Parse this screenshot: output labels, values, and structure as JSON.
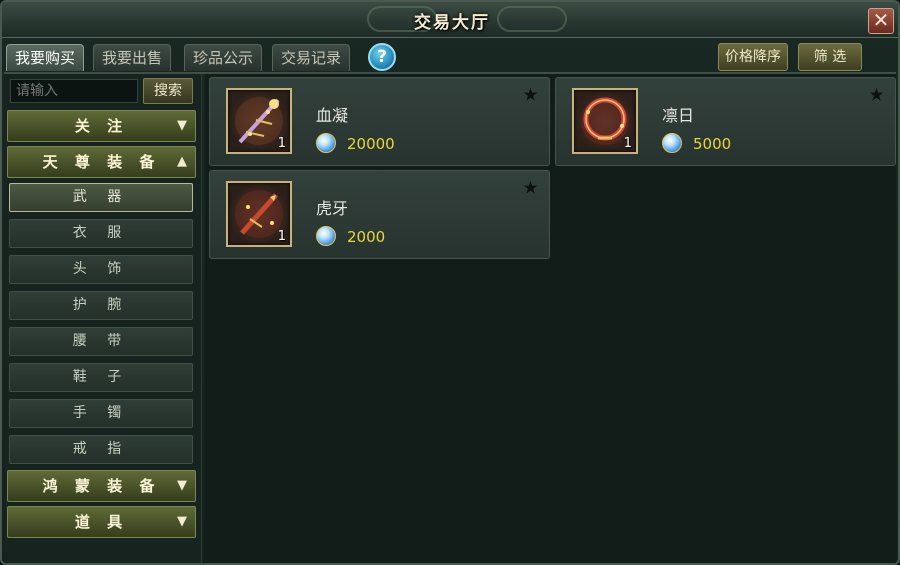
{
  "window": {
    "title": "交易大厅",
    "close_icon": "close-icon"
  },
  "tabs": [
    {
      "label": "我要购买",
      "active": true
    },
    {
      "label": "我要出售",
      "active": false
    },
    {
      "label": "珍品公示",
      "active": false
    },
    {
      "label": "交易记录",
      "active": false
    }
  ],
  "help": {
    "label": "?"
  },
  "toolbar": {
    "sort_label": "价格降序",
    "filter_label": "筛 选"
  },
  "search": {
    "placeholder": "请输入",
    "button_label": "搜索"
  },
  "sidebar": {
    "categories": [
      {
        "label": "关 注",
        "expanded": false,
        "arrow": "▼"
      },
      {
        "label": "天 尊 装 备",
        "expanded": true,
        "arrow": "▲"
      },
      {
        "label": "鸿 蒙 装 备",
        "expanded": false,
        "arrow": "▼"
      },
      {
        "label": "道 具",
        "expanded": false,
        "arrow": "▼"
      }
    ],
    "subitems": [
      {
        "label": "武 器",
        "active": true
      },
      {
        "label": "衣 服",
        "active": false
      },
      {
        "label": "头 饰",
        "active": false
      },
      {
        "label": "护 腕",
        "active": false
      },
      {
        "label": "腰 带",
        "active": false
      },
      {
        "label": "鞋 子",
        "active": false
      },
      {
        "label": "手 镯",
        "active": false
      },
      {
        "label": "戒 指",
        "active": false
      }
    ]
  },
  "items": [
    {
      "name": "血凝",
      "quantity": "1",
      "price": "20000",
      "icon": "staff-weapon-icon"
    },
    {
      "name": "凛日",
      "quantity": "1",
      "price": "5000",
      "icon": "ring-blade-weapon-icon"
    },
    {
      "name": "虎牙",
      "quantity": "1",
      "price": "2000",
      "icon": "spear-weapon-icon"
    }
  ],
  "colors": {
    "price": "#e9d63a",
    "category_bg": "#5f6a38",
    "item_frame": "#c9b277"
  }
}
